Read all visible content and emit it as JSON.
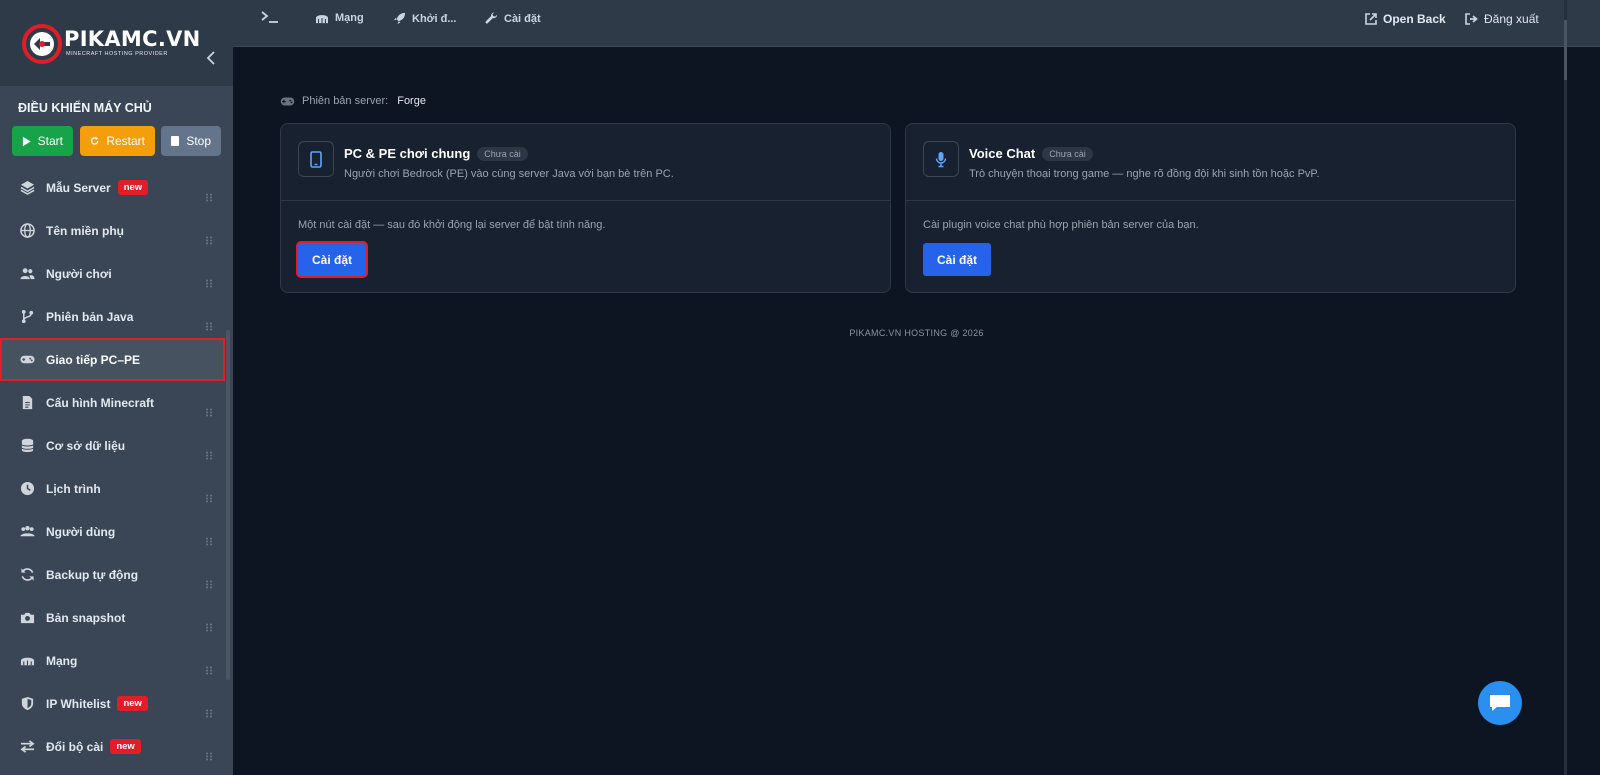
{
  "brand": {
    "name": "PIKAMC.VN",
    "subtitle": "MINECRAFT HOSTING PROVIDER",
    "accent": "#e11d2a"
  },
  "controls": {
    "title": "ĐIỀU KHIỂN MÁY CHỦ",
    "start": "Start",
    "restart": "Restart",
    "stop": "Stop"
  },
  "sidebar": {
    "items": [
      {
        "label": "Mẫu Server",
        "icon": "layers-icon",
        "badge": "new"
      },
      {
        "label": "Tên miền phụ",
        "icon": "globe-icon"
      },
      {
        "label": "Người chơi",
        "icon": "users-icon"
      },
      {
        "label": "Phiên bản Java",
        "icon": "branch-icon"
      },
      {
        "label": "Giao tiếp PC–PE",
        "icon": "gamepad-icon",
        "active": true
      },
      {
        "label": "Cấu hình Minecraft",
        "icon": "file-icon"
      },
      {
        "label": "Cơ sở dữ liệu",
        "icon": "database-icon"
      },
      {
        "label": "Lịch trình",
        "icon": "clock-icon"
      },
      {
        "label": "Người dùng",
        "icon": "users-cog-icon"
      },
      {
        "label": "Backup tự động",
        "icon": "refresh-icon"
      },
      {
        "label": "Bản snapshot",
        "icon": "camera-icon"
      },
      {
        "label": "Mạng",
        "icon": "network-icon"
      },
      {
        "label": "IP Whitelist",
        "icon": "shield-icon",
        "badge": "new"
      },
      {
        "label": "Đổi bộ cài",
        "icon": "swap-icon",
        "badge": "new"
      }
    ]
  },
  "topbar": {
    "terminal": "",
    "network": "Mạng",
    "startup": "Khởi đ...",
    "settings": "Cài đặt",
    "open_back": "Open Back",
    "logout": "Đăng xuất"
  },
  "main": {
    "version_label": "Phiên bản server:",
    "version_value": "Forge",
    "cards": [
      {
        "title": "PC & PE chơi chung",
        "status": "Chưa cài",
        "description": "Người chơi Bedrock (PE) vào cùng server Java với bạn bè trên PC.",
        "note": "Một nút cài đặt — sau đó khởi động lại server để bật tính năng.",
        "button": "Cài đặt",
        "icon": "mobile-icon"
      },
      {
        "title": "Voice Chat",
        "status": "Chưa cài",
        "description": "Trò chuyện thoại trong game — nghe rõ đồng đội khi sinh tồn hoặc PvP.",
        "note": "Cài plugin voice chat phù hợp phiên bản server của bạn.",
        "button": "Cài đặt",
        "icon": "microphone-icon"
      }
    ],
    "footer": "PIKAMC.VN HOSTING @ 2026"
  },
  "colors": {
    "install_button": "#2563eb",
    "start": "#16a34a",
    "restart": "#f59e0b",
    "stop": "#64748b",
    "chat": "#2b8ff0"
  }
}
